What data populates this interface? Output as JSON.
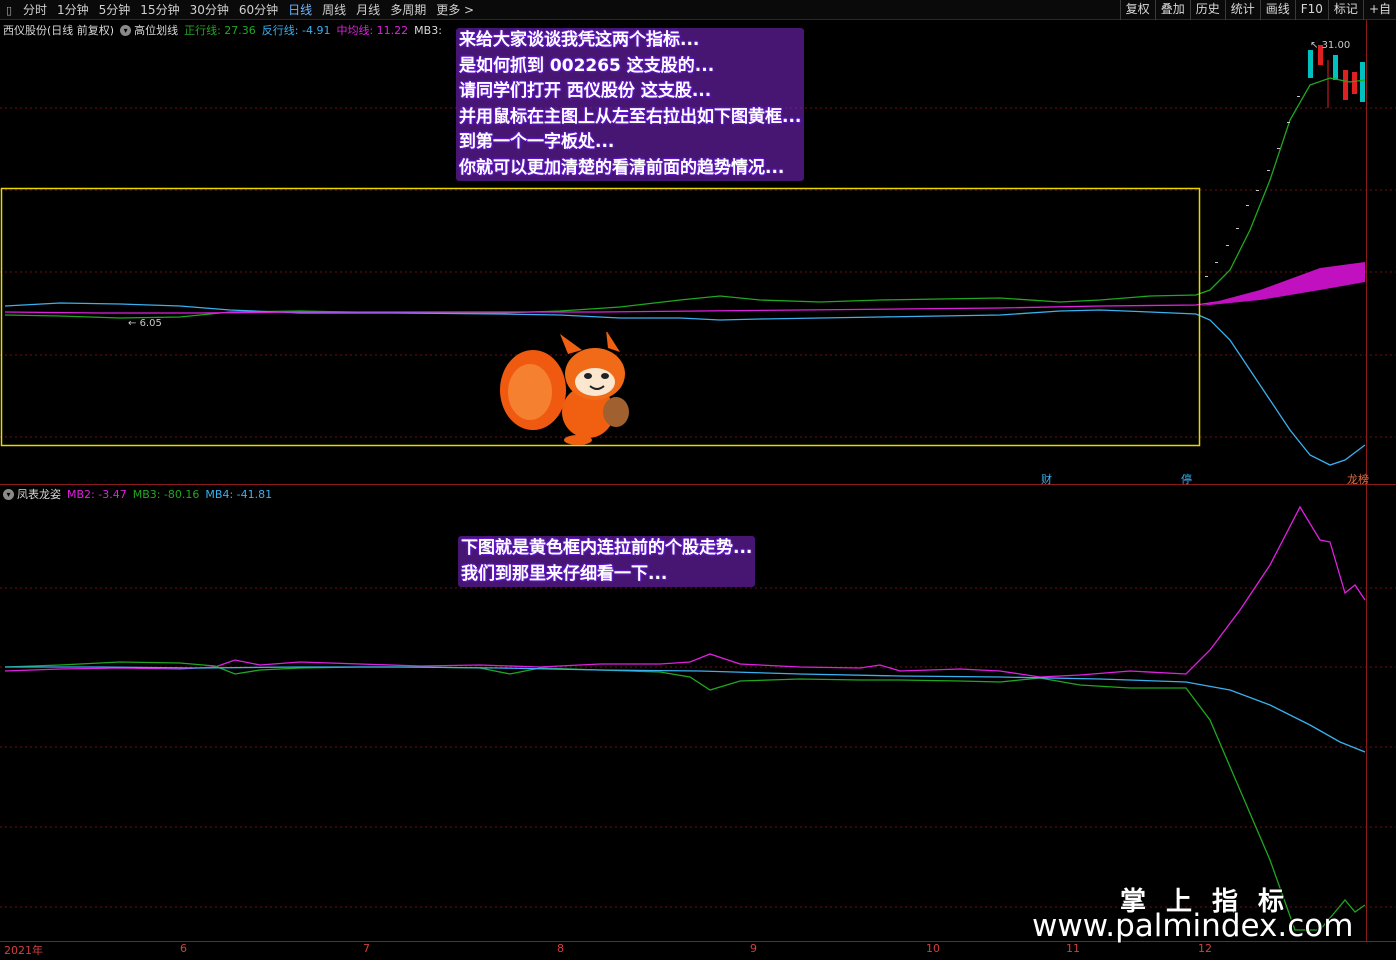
{
  "toolbar": {
    "menu_icon": "menu-icon",
    "periods": [
      "分时",
      "1分钟",
      "5分钟",
      "15分钟",
      "30分钟",
      "60分钟",
      "日线",
      "周线",
      "月线",
      "多周期",
      "更多 >"
    ],
    "right_buttons": [
      "复权",
      "叠加",
      "历史",
      "统计",
      "画线",
      "F10",
      "标记",
      "+自"
    ]
  },
  "main_panel": {
    "stock_title": "西仪股份(日线 前复权)",
    "indicator_name": "高位划线",
    "zhengxing": "正行线: 27.36",
    "fanxing": "反行线: -4.91",
    "zhongjun": "中均线: 11.22",
    "mb3": "MB3:",
    "price_high": "31.00",
    "price_low": "6.05",
    "markers": {
      "cai": "财",
      "ting": "停",
      "long": "龙榜"
    }
  },
  "sub_panel": {
    "indicator_name": "凤表龙姿",
    "mb2": "MB2: -3.47",
    "mb3": "MB3: -80.16",
    "mb4": "MB4: -41.81"
  },
  "annotations": {
    "top": [
      "来给大家谈谈我凭这两个指标...",
      "是如何抓到 002265 这支股的...",
      "请同学们打开 西仪股份 这支股...",
      "并用鼠标在主图上从左至右拉出如下图黄框...",
      "到第一个一字板处...",
      "你就可以更加清楚的看清前面的趋势情况..."
    ],
    "bottom": [
      "下图就是黄色框内连拉前的个股走势...",
      "我们到那里来仔细看一下..."
    ]
  },
  "x_axis": {
    "labels": [
      "2021年",
      "6",
      "7",
      "8",
      "9",
      "10",
      "11",
      "12"
    ]
  },
  "watermark": {
    "title": "掌上指标",
    "url": "www.palmindex.com"
  },
  "colors": {
    "zhengxing": "#1fa81f",
    "fanxing": "#3ab0f0",
    "zhongjun": "#e020e0",
    "highlight_box": "#e8d800",
    "grid": "#6b1010"
  }
}
